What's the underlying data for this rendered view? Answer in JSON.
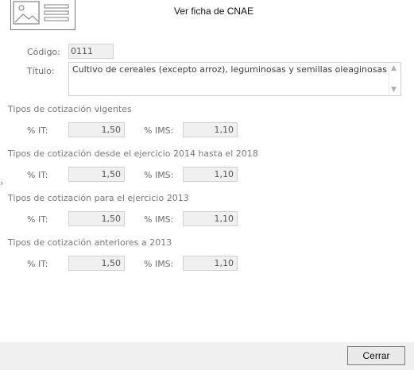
{
  "window": {
    "title": "Ver ficha de CNAE"
  },
  "icons": {
    "header": "id-card-icon",
    "side": "chevron-right-icon"
  },
  "codigo": {
    "label": "Código:",
    "value": "0111"
  },
  "titulo": {
    "label": "Título:",
    "value": "Cultivo de cereales (excepto arroz), leguminosas y semillas oleaginosas"
  },
  "sections": [
    {
      "title": "Tipos de cotización vigentes",
      "it_label": "% IT:",
      "it_value": "1,50",
      "ims_label": "% IMS:",
      "ims_value": "1,10"
    },
    {
      "title": "Tipos de cotización desde el ejercicio 2014 hasta el 2018",
      "it_label": "% IT:",
      "it_value": "1,50",
      "ims_label": "% IMS:",
      "ims_value": "1,10"
    },
    {
      "title": "Tipos de cotización para el ejercicio 2013",
      "it_label": "% IT:",
      "it_value": "1,50",
      "ims_label": "% IMS:",
      "ims_value": "1,10"
    },
    {
      "title": "Tipos de cotización anteriores a 2013",
      "it_label": "% IT:",
      "it_value": "1,50",
      "ims_label": "% IMS:",
      "ims_value": "1,10"
    }
  ],
  "footer": {
    "close_label": "Cerrar"
  }
}
